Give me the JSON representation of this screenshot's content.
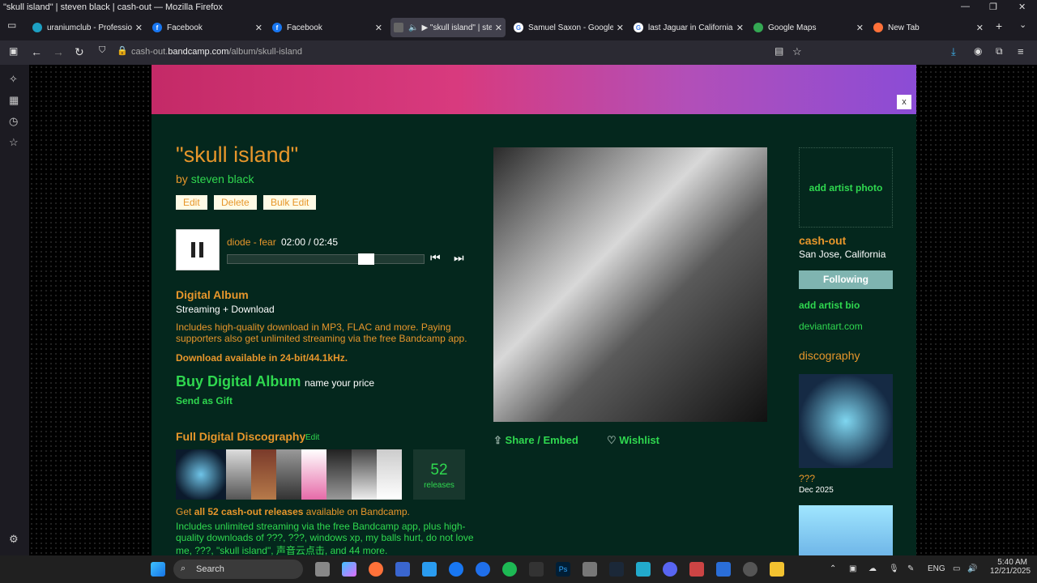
{
  "window": {
    "title": "\"skull island\" | steven black | cash-out — Mozilla Firefox"
  },
  "tabs": [
    {
      "label": "uraniumclub - Professional",
      "icon": "bandcamp-icon",
      "color": "#1da0c3"
    },
    {
      "label": "Facebook",
      "icon": "facebook-icon",
      "color": "#1877f2"
    },
    {
      "label": "Facebook",
      "icon": "facebook-icon",
      "color": "#1877f2"
    },
    {
      "label": "▶ \"skull island\" | ste",
      "icon": "speaker-icon",
      "color": "#666666"
    },
    {
      "label": "Samuel Saxon - Google Se",
      "icon": "google-icon",
      "color": "#ffffff"
    },
    {
      "label": "last Jaguar in California we",
      "icon": "google-icon",
      "color": "#ffffff"
    },
    {
      "label": "Google Maps",
      "icon": "maps-icon",
      "color": "#34a853"
    },
    {
      "label": "New Tab",
      "icon": "firefox-icon",
      "color": "#ff7139"
    }
  ],
  "address": {
    "prefix": "cash-out.",
    "domain": "bandcamp.com",
    "path": "/album/skull-island"
  },
  "album": {
    "title": "\"skull island\"",
    "by_prefix": "by",
    "artist": "steven black",
    "buttons": {
      "edit": "Edit",
      "delete": "Delete",
      "bulk_edit": "Bulk Edit"
    },
    "player": {
      "track": "diode - fear",
      "time": "02:00 / 02:45",
      "progress": 0.727
    },
    "digital": {
      "heading": "Digital Album",
      "sub": "Streaming + Download",
      "desc1": "Includes high-quality download in MP3, FLAC and more. Paying",
      "desc2": "supporters also get unlimited streaming via the free Bandcamp app.",
      "quality": "Download available in 24-bit/44.1kHz.",
      "buy": "Buy Digital Album",
      "price": "name your price",
      "gift": "Send as Gift"
    },
    "discography": {
      "heading": "Full Digital Discography",
      "edit": "Edit",
      "count": "52",
      "count_label": "releases",
      "get_prefix": "Get ",
      "get_bold": "all 52 cash-out releases",
      "get_suffix": " available on Bandcamp.",
      "inc1": "Includes unlimited streaming via the free Bandcamp app, plus high-",
      "inc2": "quality downloads of ???, ???, windows xp, my balls hurt, do not love",
      "inc3": "me, ???, \"skull island\", 声音云点击, and 44 more."
    },
    "share": "Share / Embed",
    "wishlist": "Wishlist"
  },
  "artist_panel": {
    "add_photo": "add artist photo",
    "name": "cash-out",
    "location": "San Jose, California",
    "following": "Following",
    "add_bio": "add artist bio",
    "link": "deviantart.com",
    "discography": "discography",
    "release1_title": "???",
    "release1_date": "Dec 2025"
  },
  "taskbar": {
    "search": "Search",
    "lang": "ENG",
    "time": "5:40 AM",
    "date": "12/21/2025"
  },
  "colors": {
    "accent_orange": "#e7962b",
    "accent_green": "#2fd84f",
    "page_bg": "#04271d"
  }
}
